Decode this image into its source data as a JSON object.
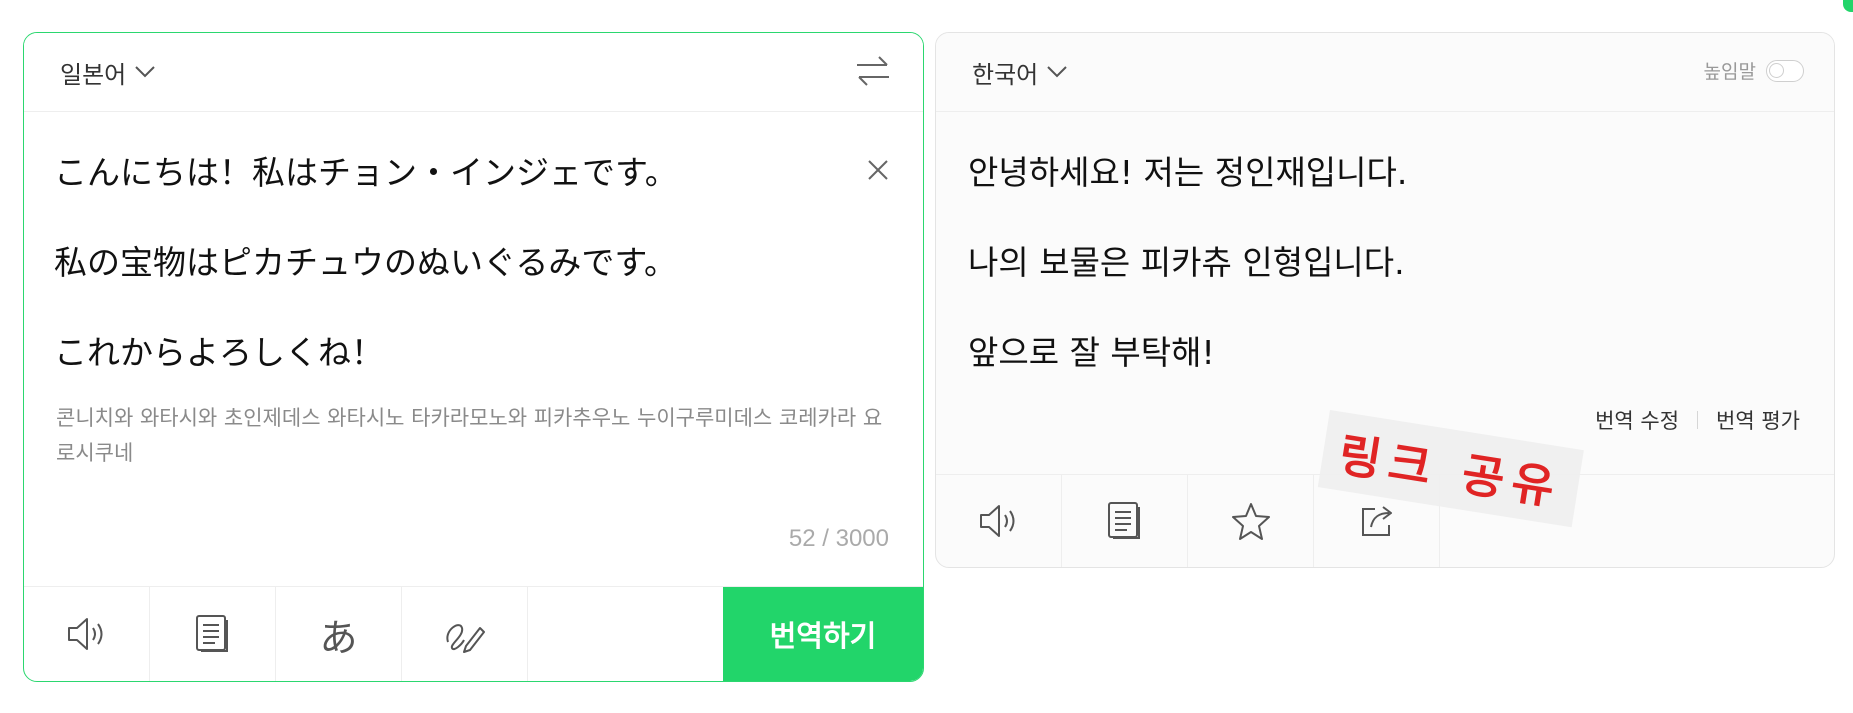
{
  "source": {
    "language": "일본어",
    "lines": [
      "こんにちは！私はチョン・インジェです。",
      "私の宝物はピカチュウのぬいぐるみです。",
      "これからよろしくね！"
    ],
    "pronunciation": "콘니치와 와타시와 초인제데스 와타시노 타카라모노와 피카추우노 누이구루미데스 코레카라 요로시쿠네",
    "char_count": "52 / 3000",
    "handwriting_glyph": "あ",
    "translate_button": "번역하기",
    "icons": [
      "speaker-icon",
      "document-icon",
      "hiragana-icon",
      "handwriting-pen-icon",
      "swap-icon",
      "close-icon",
      "chevron-down-icon"
    ]
  },
  "target": {
    "language": "한국어",
    "honorific_label": "높임말",
    "honorific_on": false,
    "lines": [
      "안녕하세요! 저는 정인재입니다.",
      "나의 보물은 피카츄 인형입니다.",
      "앞으로 잘 부탁해!"
    ],
    "edit_translation": "번역 수정",
    "rate_translation": "번역 평가",
    "icons": [
      "speaker-icon",
      "document-icon",
      "star-icon",
      "share-icon",
      "chevron-down-icon"
    ]
  },
  "annotation": {
    "stamp_text": "링크 공유"
  },
  "colors": {
    "accent": "#22d56a",
    "stamp_text": "#e02424"
  }
}
